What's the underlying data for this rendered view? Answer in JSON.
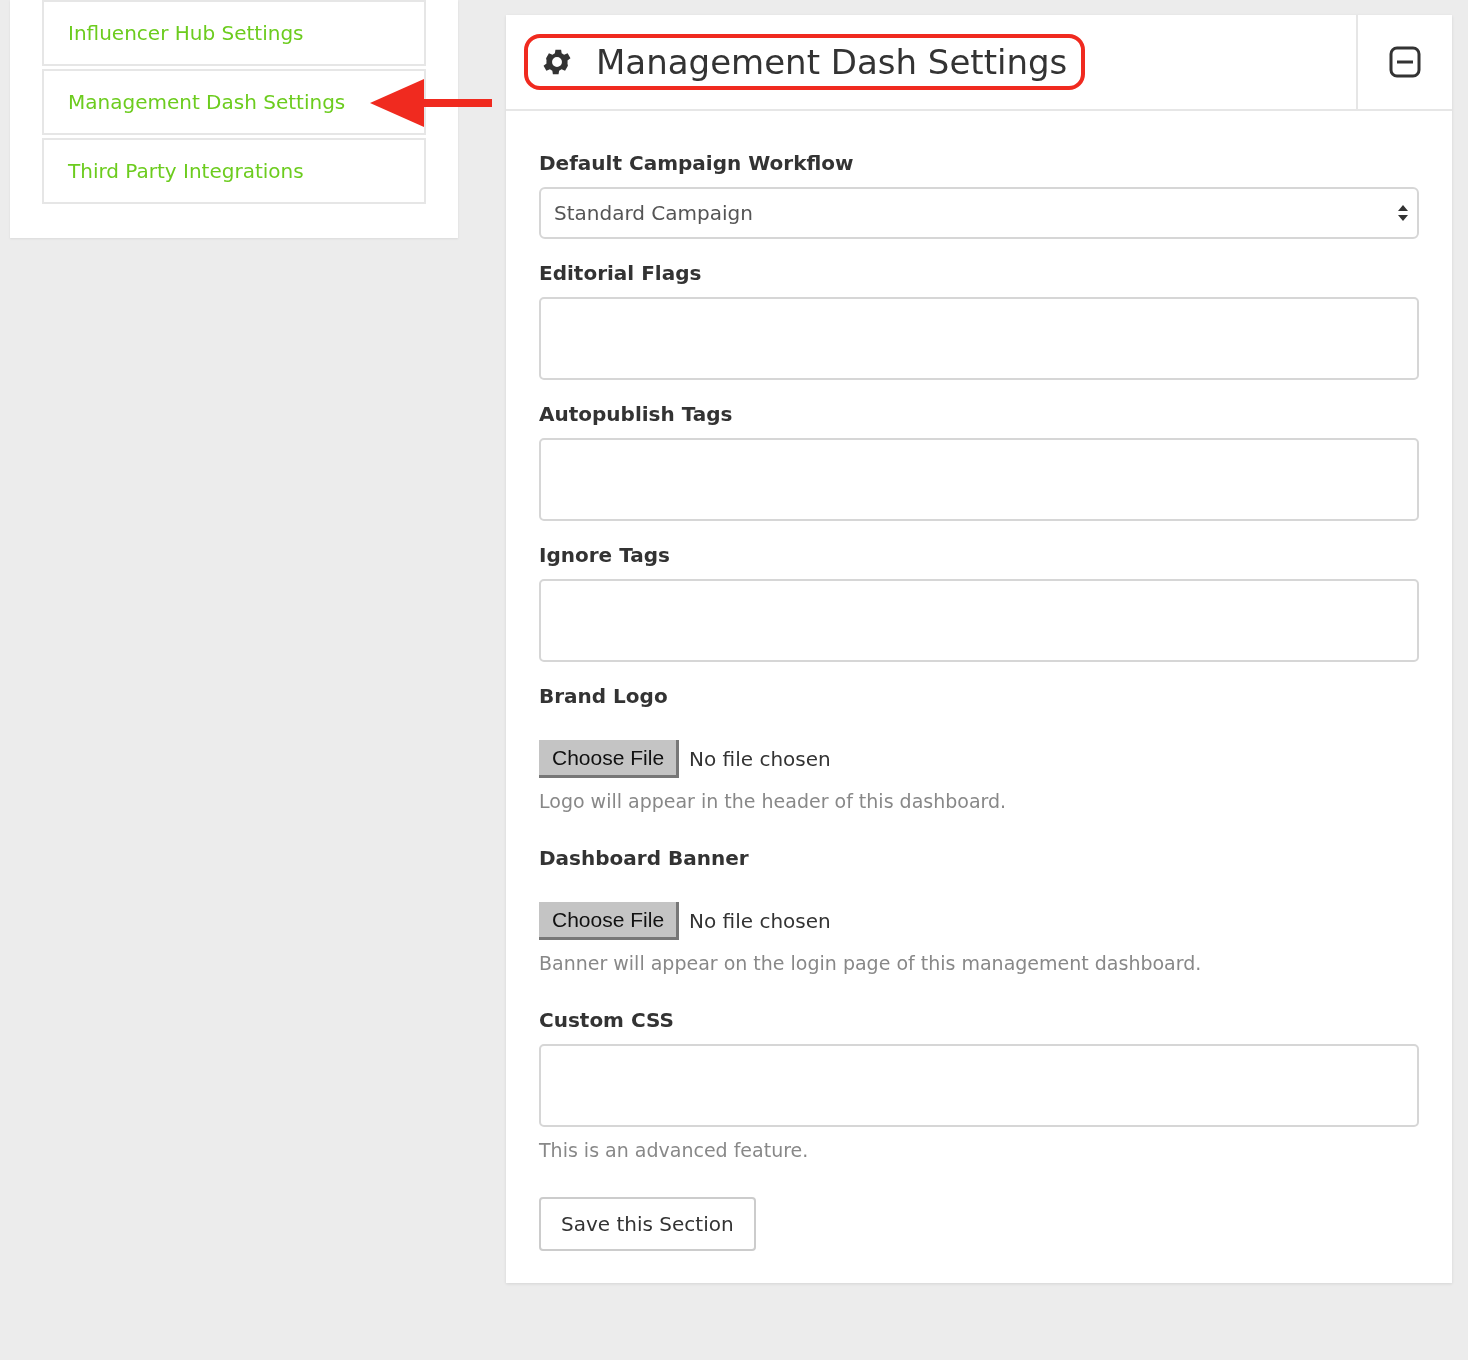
{
  "sidebar": {
    "items": [
      {
        "label": "Influencer Hub Settings"
      },
      {
        "label": "Management Dash Settings"
      },
      {
        "label": "Third Party Integrations"
      }
    ]
  },
  "panel": {
    "title": "Management Dash Settings",
    "fields": [
      {
        "kind": "select",
        "label": "Default Campaign Workflow",
        "value": "Standard Campaign"
      },
      {
        "kind": "text",
        "label": "Editorial Flags"
      },
      {
        "kind": "text",
        "label": "Autopublish Tags"
      },
      {
        "kind": "text",
        "label": "Ignore Tags"
      },
      {
        "kind": "file",
        "label": "Brand Logo",
        "button": "Choose File",
        "status": "No file chosen",
        "help": "Logo will appear in the header of this dashboard."
      },
      {
        "kind": "file",
        "label": "Dashboard Banner",
        "button": "Choose File",
        "status": "No file chosen",
        "help": "Banner will appear on the login page of this management dashboard."
      },
      {
        "kind": "text",
        "label": "Custom CSS",
        "help": "This is an advanced feature."
      }
    ],
    "save_button": "Save this Section"
  }
}
